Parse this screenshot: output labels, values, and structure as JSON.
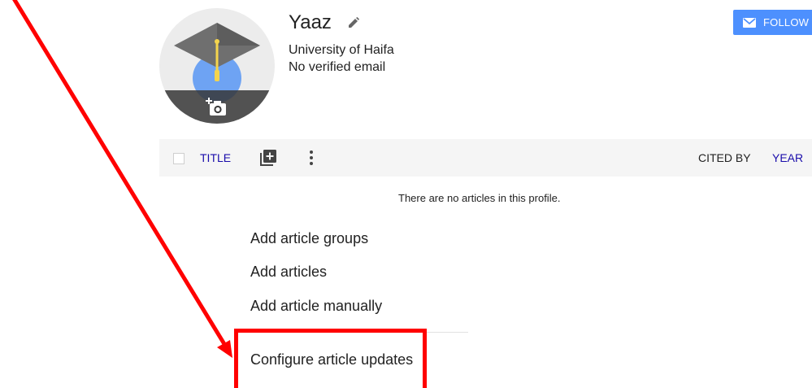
{
  "profile": {
    "name": "Yaaz",
    "affiliation": "University of Haifa",
    "email_status": "No verified email",
    "avatar_icon": "graduation-cap-icon",
    "photo_icon": "add-photo-icon",
    "edit_icon": "pencil-icon"
  },
  "follow_button": {
    "label": "FOLLOW",
    "icon": "envelope-icon",
    "color": "#4d90fe"
  },
  "table_header": {
    "title_label": "TITLE",
    "add_icon": "add-box-icon",
    "more_icon": "more-vertical-icon",
    "cited_by_label": "CITED BY",
    "year_label": "YEAR"
  },
  "empty_message": "There are no articles in this profile.",
  "menu": {
    "items": [
      {
        "label": "Add article groups"
      },
      {
        "label": "Add articles"
      },
      {
        "label": "Add article manually"
      },
      {
        "label": "Configure article updates"
      }
    ]
  },
  "annotation": {
    "color": "#ff0000"
  }
}
